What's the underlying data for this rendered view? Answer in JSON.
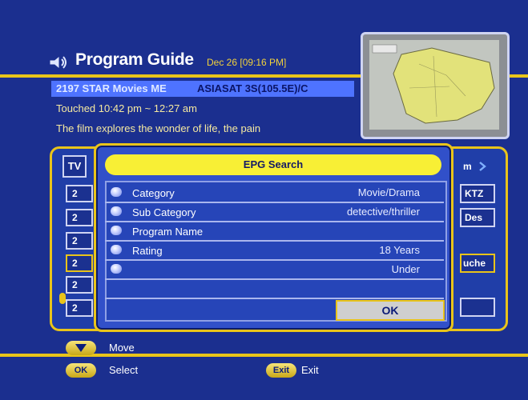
{
  "header": {
    "title": "Program Guide",
    "datetime": "Dec 26 [09:16 PM]"
  },
  "channel": {
    "name": "2197  STAR Movies ME",
    "satellite": "ASIASAT 3S(105.5E)/C"
  },
  "program": {
    "title_time": "Touched  10:42 pm ~ 12:27 am",
    "description": "The film explores the wonder of life, the pain"
  },
  "background_list": {
    "tab_label": "TV",
    "rows": [
      "2",
      "2",
      "2",
      "2",
      "2",
      "2"
    ],
    "right_labels": {
      "row0": "m",
      "row1": "KTZ",
      "row2": "Des",
      "row4": "uche"
    }
  },
  "epg_dialog": {
    "title": "EPG Search",
    "fields": [
      {
        "label": "Category",
        "value": "Movie/Drama"
      },
      {
        "label": "Sub Category",
        "value": "detective/thriller"
      },
      {
        "label": "Program Name",
        "value": ""
      },
      {
        "label": "Rating",
        "value": "18 Years"
      },
      {
        "label": "",
        "value": "Under"
      }
    ],
    "ok_label": "OK"
  },
  "footer": {
    "move_label": "Move",
    "select_btn": "OK",
    "select_label": "Select",
    "exit_btn": "Exit",
    "exit_label": "Exit"
  },
  "colors": {
    "background": "#1b2f8f",
    "accent_yellow": "#e9c41a",
    "highlight_blue": "#4e73ff",
    "dialog_title_yellow": "#f8ef35"
  }
}
